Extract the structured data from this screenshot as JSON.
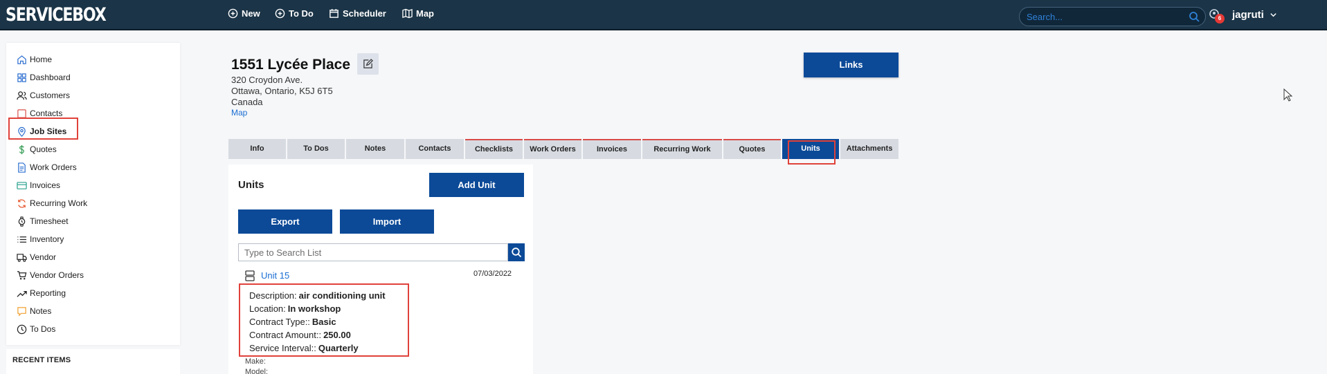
{
  "app": {
    "brand": "SERVICEBOX"
  },
  "topnav": {
    "new": "New",
    "todo": "To Do",
    "scheduler": "Scheduler",
    "map": "Map"
  },
  "search": {
    "placeholder": "Search..."
  },
  "notifications": {
    "count": "6"
  },
  "user": {
    "name": "jagruti"
  },
  "sidebar": {
    "items": [
      {
        "label": "Home",
        "icon": "home-icon"
      },
      {
        "label": "Dashboard",
        "icon": "dashboard-icon"
      },
      {
        "label": "Customers",
        "icon": "customers-icon"
      },
      {
        "label": "Contacts",
        "icon": "contacts-icon"
      },
      {
        "label": "Job Sites",
        "icon": "location-pin-icon"
      },
      {
        "label": "Quotes",
        "icon": "dollar-icon"
      },
      {
        "label": "Work Orders",
        "icon": "document-icon"
      },
      {
        "label": "Invoices",
        "icon": "card-icon"
      },
      {
        "label": "Recurring Work",
        "icon": "recurring-icon"
      },
      {
        "label": "Timesheet",
        "icon": "watch-icon"
      },
      {
        "label": "Inventory",
        "icon": "list-icon"
      },
      {
        "label": "Vendor",
        "icon": "truck-icon"
      },
      {
        "label": "Vendor Orders",
        "icon": "cart-icon"
      },
      {
        "label": "Reporting",
        "icon": "trend-icon"
      },
      {
        "label": "Notes",
        "icon": "note-icon"
      },
      {
        "label": "To Dos",
        "icon": "clock-icon"
      }
    ],
    "recent_title": "RECENT ITEMS"
  },
  "site": {
    "title": "1551 Lycée Place",
    "address_line1": "320 Croydon Ave.",
    "address_line2": "Ottawa, Ontario, K5J 6T5",
    "country": "Canada",
    "map_link": "Map"
  },
  "links_button": "Links",
  "tabs": [
    "Info",
    "To Dos",
    "Notes",
    "Contacts",
    "Checklists",
    "Work Orders",
    "Invoices",
    "Recurring Work",
    "Quotes",
    "Units",
    "Attachments"
  ],
  "units": {
    "title": "Units",
    "add_button": "Add Unit",
    "export_button": "Export",
    "import_button": "Import",
    "search_placeholder": "Type to Search List",
    "item": {
      "name": "Unit 15",
      "date": "07/03/2022",
      "description_label": "Description:",
      "description": "air conditioning unit",
      "location_label": "Location:",
      "location": "In workshop",
      "contract_type_label": "Contract Type::",
      "contract_type": "Basic",
      "contract_amount_label": "Contract Amount::",
      "contract_amount": "250.00",
      "service_interval_label": "Service Interval::",
      "service_interval": "Quarterly",
      "make_label": "Make:",
      "model_label": "Model:"
    }
  },
  "colors": {
    "topbar": "#1b3447",
    "primary": "#0c4a98",
    "link": "#1b6fd3",
    "highlight": "#e0413a"
  }
}
